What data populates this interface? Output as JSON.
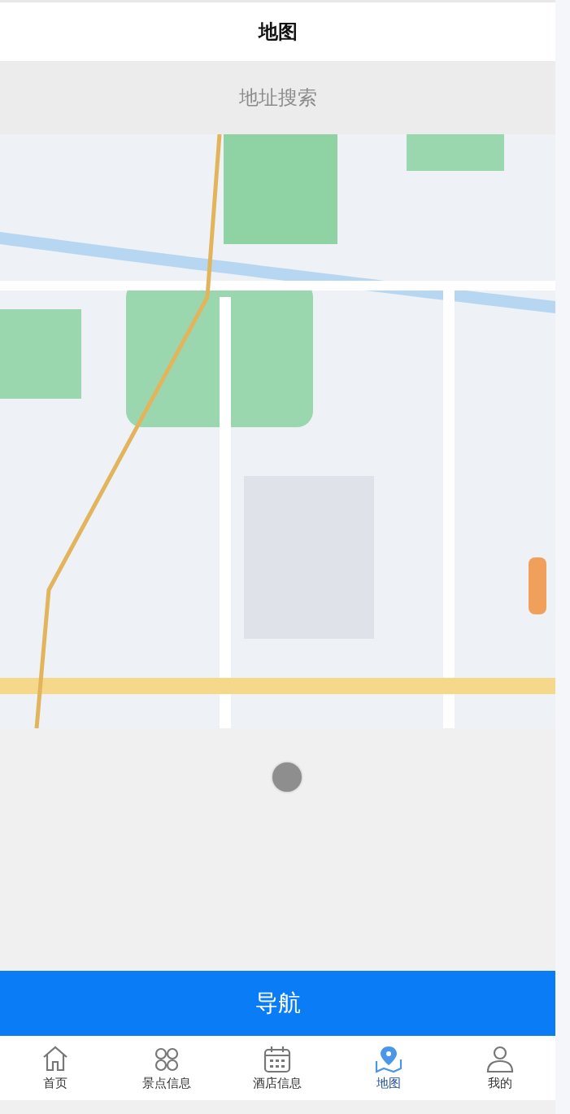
{
  "header": {
    "title": "地图"
  },
  "search": {
    "placeholder": "地址搜索"
  },
  "action_button": {
    "label": "导航"
  },
  "tab_bar": [
    {
      "label": "首页",
      "kind": "home",
      "selected": false
    },
    {
      "label": "景点信息",
      "kind": "grid",
      "selected": false
    },
    {
      "label": "酒店信息",
      "kind": "calendar",
      "selected": false
    },
    {
      "label": "地图",
      "kind": "map",
      "selected": true
    },
    {
      "label": "我的",
      "kind": "person",
      "selected": false
    }
  ]
}
